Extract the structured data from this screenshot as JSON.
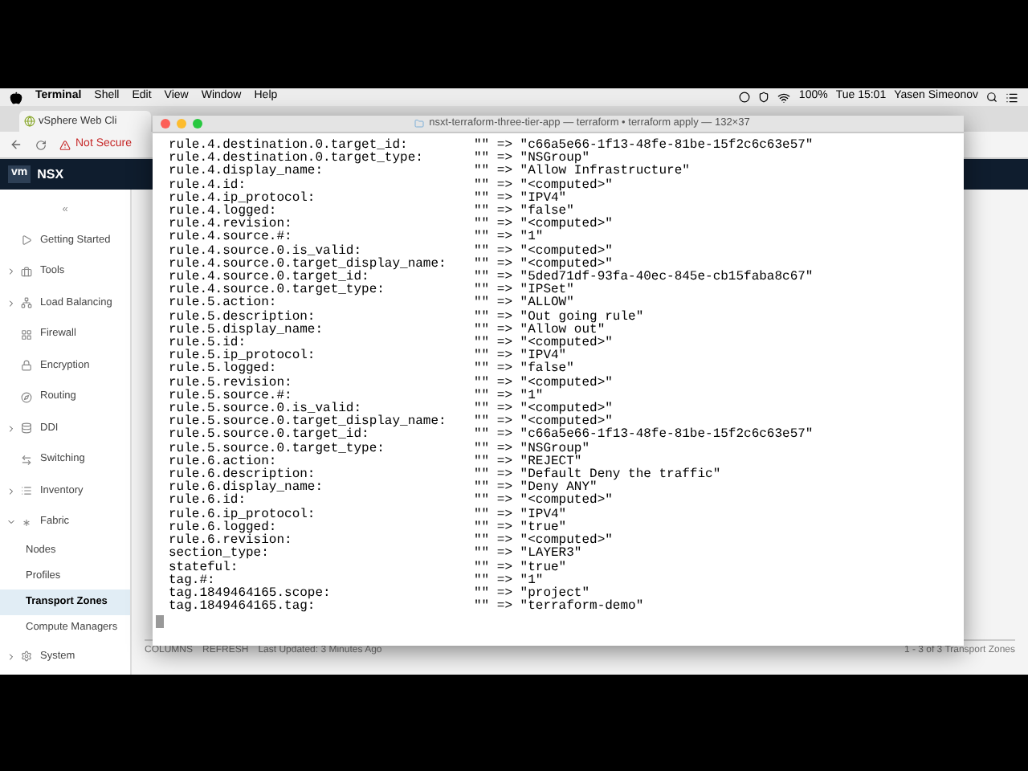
{
  "menu_bar": {
    "app": "Terminal",
    "menus": [
      "Shell",
      "Edit",
      "View",
      "Window",
      "Help"
    ],
    "battery": "100%",
    "clock": "Tue 15:01",
    "user": "Yasen Simeonov"
  },
  "browser": {
    "tab": "vSphere Web Cli",
    "security": "Not Secure",
    "logo": "vm",
    "app_name": "NSX",
    "collapse": "«",
    "sidebar": [
      {
        "label": "Getting Started",
        "selected": false
      },
      {
        "label": "Tools",
        "expanded": false,
        "selected": false
      },
      {
        "label": "Load Balancing",
        "expanded": false,
        "selected": false
      },
      {
        "label": "Firewall",
        "selected": false
      },
      {
        "label": "Encryption",
        "selected": false
      },
      {
        "label": "Routing",
        "selected": false
      },
      {
        "label": "DDI",
        "expanded": false,
        "selected": false
      },
      {
        "label": "Switching",
        "selected": false
      },
      {
        "label": "Inventory",
        "expanded": false,
        "selected": false
      },
      {
        "label": "Fabric",
        "expanded": true,
        "selected": false,
        "children": [
          {
            "label": "Nodes",
            "selected": false
          },
          {
            "label": "Profiles",
            "selected": false
          },
          {
            "label": "Transport Zones",
            "selected": true
          },
          {
            "label": "Compute Managers",
            "selected": false
          }
        ]
      },
      {
        "label": "System",
        "expanded": false,
        "selected": false
      }
    ],
    "footer": {
      "columns": "COLUMNS",
      "refresh": "REFRESH",
      "updated": "Last Updated: 3 Minutes Ago",
      "pager": "1 - 3 of 3 Transport Zones"
    }
  },
  "terminal": {
    "title": "nsxt-terraform-three-tier-app — terraform • terraform apply — 132×37",
    "lines": [
      {
        "key": "rule.4.destination.0.target_id:",
        "change": "\"\" => \"c66a5e66-1f13-48fe-81be-15f2c6c63e57\""
      },
      {
        "key": "rule.4.destination.0.target_type:",
        "change": "\"\" => \"NSGroup\""
      },
      {
        "key": "rule.4.display_name:",
        "change": "\"\" => \"Allow Infrastructure\""
      },
      {
        "key": "rule.4.id:",
        "change": "\"\" => \"<computed>\""
      },
      {
        "key": "rule.4.ip_protocol:",
        "change": "\"\" => \"IPV4\""
      },
      {
        "key": "rule.4.logged:",
        "change": "\"\" => \"false\""
      },
      {
        "key": "rule.4.revision:",
        "change": "\"\" => \"<computed>\""
      },
      {
        "key": "rule.4.source.#:",
        "change": "\"\" => \"1\""
      },
      {
        "key": "rule.4.source.0.is_valid:",
        "change": "\"\" => \"<computed>\""
      },
      {
        "key": "rule.4.source.0.target_display_name:",
        "change": "\"\" => \"<computed>\""
      },
      {
        "key": "rule.4.source.0.target_id:",
        "change": "\"\" => \"5ded71df-93fa-40ec-845e-cb15faba8c67\""
      },
      {
        "key": "rule.4.source.0.target_type:",
        "change": "\"\" => \"IPSet\""
      },
      {
        "key": "rule.5.action:",
        "change": "\"\" => \"ALLOW\""
      },
      {
        "key": "rule.5.description:",
        "change": "\"\" => \"Out going rule\""
      },
      {
        "key": "rule.5.display_name:",
        "change": "\"\" => \"Allow out\""
      },
      {
        "key": "rule.5.id:",
        "change": "\"\" => \"<computed>\""
      },
      {
        "key": "rule.5.ip_protocol:",
        "change": "\"\" => \"IPV4\""
      },
      {
        "key": "rule.5.logged:",
        "change": "\"\" => \"false\""
      },
      {
        "key": "rule.5.revision:",
        "change": "\"\" => \"<computed>\""
      },
      {
        "key": "rule.5.source.#:",
        "change": "\"\" => \"1\""
      },
      {
        "key": "rule.5.source.0.is_valid:",
        "change": "\"\" => \"<computed>\""
      },
      {
        "key": "rule.5.source.0.target_display_name:",
        "change": "\"\" => \"<computed>\""
      },
      {
        "key": "rule.5.source.0.target_id:",
        "change": "\"\" => \"c66a5e66-1f13-48fe-81be-15f2c6c63e57\""
      },
      {
        "key": "rule.5.source.0.target_type:",
        "change": "\"\" => \"NSGroup\""
      },
      {
        "key": "rule.6.action:",
        "change": "\"\" => \"REJECT\""
      },
      {
        "key": "rule.6.description:",
        "change": "\"\" => \"Default Deny the traffic\""
      },
      {
        "key": "rule.6.display_name:",
        "change": "\"\" => \"Deny ANY\""
      },
      {
        "key": "rule.6.id:",
        "change": "\"\" => \"<computed>\""
      },
      {
        "key": "rule.6.ip_protocol:",
        "change": "\"\" => \"IPV4\""
      },
      {
        "key": "rule.6.logged:",
        "change": "\"\" => \"true\""
      },
      {
        "key": "rule.6.revision:",
        "change": "\"\" => \"<computed>\""
      },
      {
        "key": "section_type:",
        "change": "\"\" => \"LAYER3\""
      },
      {
        "key": "stateful:",
        "change": "\"\" => \"true\""
      },
      {
        "key": "tag.#:",
        "change": "\"\" => \"1\""
      },
      {
        "key": "tag.1849464165.scope:",
        "change": "\"\" => \"project\""
      },
      {
        "key": "tag.1849464165.tag:",
        "change": "\"\" => \"terraform-demo\""
      }
    ]
  }
}
